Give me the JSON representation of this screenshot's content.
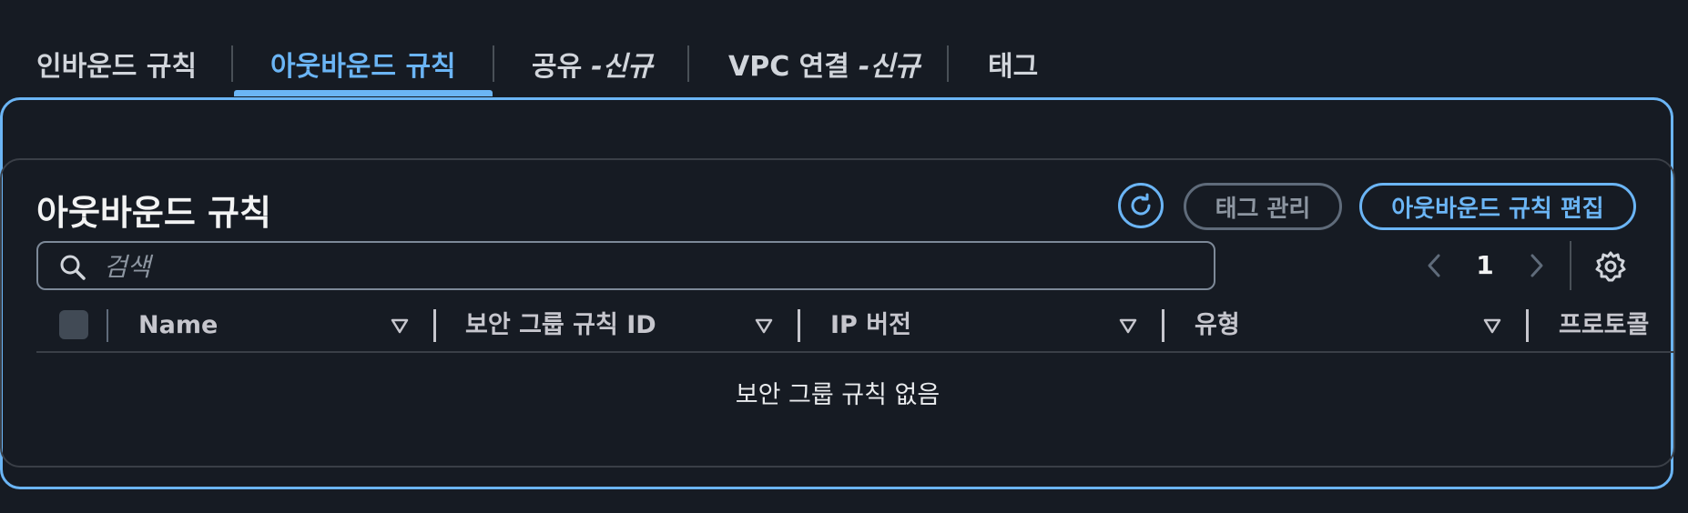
{
  "tabs": [
    {
      "label": "인바운드 규칙",
      "new_tag": ""
    },
    {
      "label": "아웃바운드 규칙",
      "new_tag": ""
    },
    {
      "label": "공유",
      "new_tag": "-신규"
    },
    {
      "label": "VPC 연결",
      "new_tag": "-신규"
    },
    {
      "label": "태그",
      "new_tag": ""
    }
  ],
  "active_tab": "아웃바운드 규칙",
  "section": {
    "title": "아웃바운드 규칙",
    "refresh_icon": "refresh-icon",
    "manage_tags_label": "태그 관리",
    "edit_rules_label": "아웃바운드 규칙 편집"
  },
  "search": {
    "placeholder": "검색",
    "value": "",
    "icon": "search-icon"
  },
  "pagination": {
    "current_page": "1",
    "prev_icon": "chevron-left-icon",
    "next_icon": "chevron-right-icon",
    "settings_icon": "gear-icon"
  },
  "table": {
    "columns": [
      "Name",
      "보안 그룹 규칙 ID",
      "IP 버전",
      "유형",
      "프로토콜"
    ],
    "sort_icon": "sort-down-icon",
    "empty_message": "보안 그룹 규칙 없음"
  },
  "colors": {
    "accent": "#6bb5f5",
    "background": "#161b23",
    "border": "#3a3f47",
    "muted_text": "#8d96a1"
  }
}
